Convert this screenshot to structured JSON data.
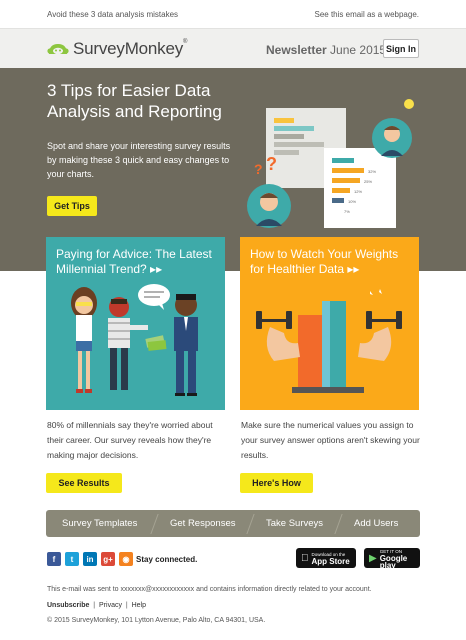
{
  "preheader": {
    "text": "Avoid these 3 data analysis mistakes",
    "view_web": "See this email as a webpage."
  },
  "header": {
    "brand": "SurveyMonkey",
    "trademark": "®",
    "newsletter_label": "Newsletter",
    "issue_date": "June 2015",
    "signin_label": "Sign In"
  },
  "hero": {
    "title": "3 Tips for Easier Data Analysis and Reporting",
    "body": "Spot and share your interesting survey results by making these 3 quick and easy changes to your charts.",
    "cta": "Get Tips",
    "chart_labels": [
      "32%",
      "25%",
      "12%",
      "10%",
      "7%"
    ]
  },
  "cards": [
    {
      "title": "Paying for Advice: The Latest Millennial Trend? ▸▸",
      "description": "80% of millennials say they're worried about their career. Our survey reveals how they're making major decisions.",
      "cta": "See Results",
      "accent": "#3eaaa9"
    },
    {
      "title": "How to Watch Your Weights for Healthier Data ▸▸",
      "description": "Make sure the numerical values you assign to your survey answer options aren't skewing your results.",
      "cta": "Here's How",
      "accent": "#fba919"
    }
  ],
  "nav": {
    "items": [
      "Survey Templates",
      "Get Responses",
      "Take Surveys",
      "Add Users"
    ]
  },
  "social": {
    "icons": [
      {
        "name": "facebook-icon",
        "glyph": "f",
        "color": "#3b5998"
      },
      {
        "name": "twitter-icon",
        "glyph": "t",
        "color": "#1da1d9"
      },
      {
        "name": "linkedin-icon",
        "glyph": "in",
        "color": "#0077b5"
      },
      {
        "name": "googleplus-icon",
        "glyph": "g+",
        "color": "#dc4a38"
      },
      {
        "name": "rss-icon",
        "glyph": "◉",
        "color": "#f4821f"
      }
    ],
    "stay_connected": "Stay connected.",
    "appstore_small": "Download on the",
    "appstore_big": "App Store",
    "googleplay_small": "GET IT ON",
    "googleplay_big": "Google play"
  },
  "footer": {
    "notice_prefix": "This e-mail was sent to",
    "masked_email": "xxxxxxx@xxxxxxxxxxxx",
    "notice_suffix": "and contains information directly related to your account.",
    "links": [
      "Unsubscribe",
      "Privacy",
      "Help"
    ],
    "separator": "|",
    "copyright": "© 2015 SurveyMonkey, 101 Lytton Avenue, Palo Alto, CA 94301, USA."
  },
  "colors": {
    "hero_bg": "#6e6a5d",
    "button_yellow": "#f5e81b",
    "nav_bg": "#8a8878",
    "brand_green": "#8dc63f"
  }
}
